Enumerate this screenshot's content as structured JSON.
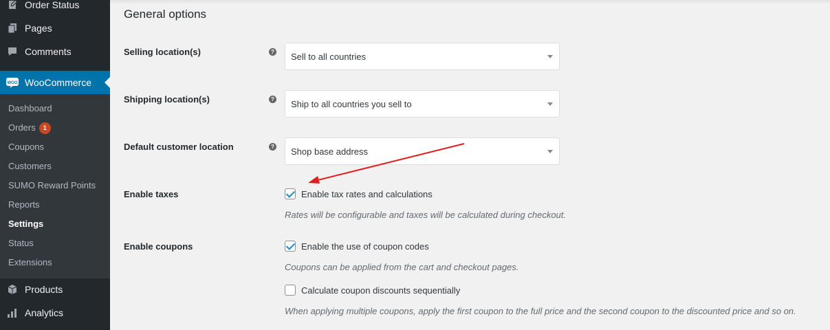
{
  "sidebar": {
    "top_items": [
      {
        "label": "Order Status",
        "icon": "pin-icon"
      },
      {
        "label": "Pages",
        "icon": "pages-icon"
      },
      {
        "label": "Comments",
        "icon": "comment-icon"
      }
    ],
    "woocommerce": {
      "label": "WooCommerce",
      "icon_text": "WOO"
    },
    "submenu": [
      {
        "label": "Dashboard"
      },
      {
        "label": "Orders",
        "badge": "1"
      },
      {
        "label": "Coupons"
      },
      {
        "label": "Customers"
      },
      {
        "label": "SUMO Reward Points"
      },
      {
        "label": "Reports"
      },
      {
        "label": "Settings",
        "current": true
      },
      {
        "label": "Status"
      },
      {
        "label": "Extensions"
      }
    ],
    "bottom_items": [
      {
        "label": "Products",
        "icon": "box-icon"
      },
      {
        "label": "Analytics",
        "icon": "bar-chart-icon"
      }
    ]
  },
  "main": {
    "section_title": "General options",
    "selling": {
      "label": "Selling location(s)",
      "value": "Sell to all countries"
    },
    "shipping": {
      "label": "Shipping location(s)",
      "value": "Ship to all countries you sell to"
    },
    "customer_location": {
      "label": "Default customer location",
      "value": "Shop base address"
    },
    "taxes": {
      "label": "Enable taxes",
      "checkbox_label": "Enable tax rates and calculations",
      "checked": true,
      "description": "Rates will be configurable and taxes will be calculated during checkout."
    },
    "coupons": {
      "label": "Enable coupons",
      "checkbox_label": "Enable the use of coupon codes",
      "checked": true,
      "description": "Coupons can be applied from the cart and checkout pages.",
      "sequential_label": "Calculate coupon discounts sequentially",
      "sequential_checked": false,
      "sequential_description": "When applying multiple coupons, apply the first coupon to the full price and the second coupon to the discounted price and so on."
    }
  },
  "colors": {
    "sidebar_bg": "#23282d",
    "submenu_bg": "#32373c",
    "active_bg": "#0073aa",
    "badge": "#ca4a1f",
    "annotation_arrow": "#e02020"
  }
}
